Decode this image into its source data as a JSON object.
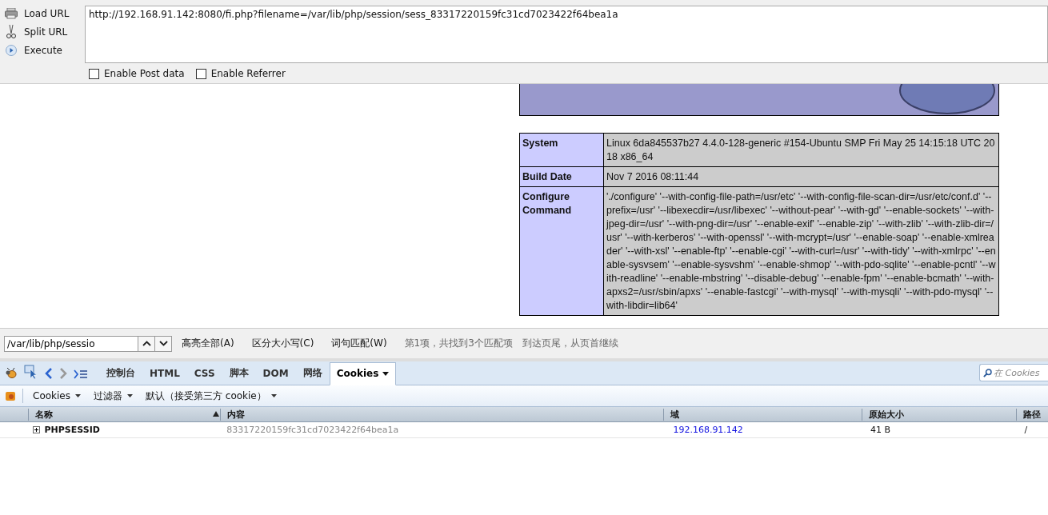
{
  "hackbar": {
    "actions": [
      {
        "kind": "load",
        "label": "Load URL"
      },
      {
        "kind": "split",
        "label": "Split URL"
      },
      {
        "kind": "execute",
        "label": "Execute"
      }
    ],
    "url": "http://192.168.91.142:8080/fi.php?filename=/var/lib/php/session/sess_83317220159fc31cd7023422f64bea1a",
    "options": [
      {
        "label": "Enable Post data",
        "checked": false
      },
      {
        "label": "Enable Referrer",
        "checked": false
      }
    ]
  },
  "phpinfo": {
    "rows": [
      {
        "key": "System",
        "value": "Linux 6da845537b27 4.4.0-128-generic #154-Ubuntu SMP Fri May 25 14:15:18 UTC 2018 x86_64"
      },
      {
        "key": "Build Date",
        "value": "Nov 7 2016 08:11:44"
      },
      {
        "key": "Configure Command",
        "value": "'./configure' '--with-config-file-path=/usr/etc' '--with-config-file-scan-dir=/usr/etc/conf.d' '--prefix=/usr' '--libexecdir=/usr/libexec' '--without-pear' '--with-gd' '--enable-sockets' '--with-jpeg-dir=/usr' '--with-png-dir=/usr' '--enable-exif' '--enable-zip' '--with-zlib' '--with-zlib-dir=/usr' '--with-kerberos' '--with-openssl' '--with-mcrypt=/usr' '--enable-soap' '--enable-xmlreader' '--with-xsl' '--enable-ftp' '--enable-cgi' '--with-curl=/usr' '--with-tidy' '--with-xmlrpc' '--enable-sysvsem' '--enable-sysvshm' '--enable-shmop' '--with-pdo-sqlite' '--enable-pcntl' '--with-readline' '--enable-mbstring' '--disable-debug' '--enable-fpm' '--enable-bcmath' '--with-apxs2=/usr/sbin/apxs' '--enable-fastcgi' '--with-mysql' '--with-mysqli' '--with-pdo-mysql' '--with-libdir=lib64'"
      }
    ]
  },
  "find_bar": {
    "query": "/var/lib/php/sessio",
    "buttons": [
      "高亮全部(A)",
      "区分大小写(C)",
      "词句匹配(W)"
    ],
    "status": [
      "第1项，共找到3个匹配项",
      "到达页尾，从页首继续"
    ]
  },
  "devtools": {
    "tabs": [
      {
        "label": "控制台",
        "selected": false
      },
      {
        "label": "HTML",
        "selected": false
      },
      {
        "label": "CSS",
        "selected": false
      },
      {
        "label": "脚本",
        "selected": false
      },
      {
        "label": "DOM",
        "selected": false
      },
      {
        "label": "网络",
        "selected": false
      },
      {
        "label": "Cookies",
        "selected": true
      }
    ],
    "search": {
      "placeholder": "在 Cookies"
    },
    "menus": [
      "Cookies",
      "过滤器",
      "默认（接受第三方 cookie）"
    ],
    "columns": [
      "名称",
      "内容",
      "域",
      "原始大小",
      "路径"
    ],
    "rows": [
      {
        "name": "PHPSESSID",
        "value": "83317220159fc31cd7023422f64bea1a",
        "domain": "192.168.91.142",
        "size": "41 B",
        "path": "/",
        "expanded": false
      }
    ]
  }
}
